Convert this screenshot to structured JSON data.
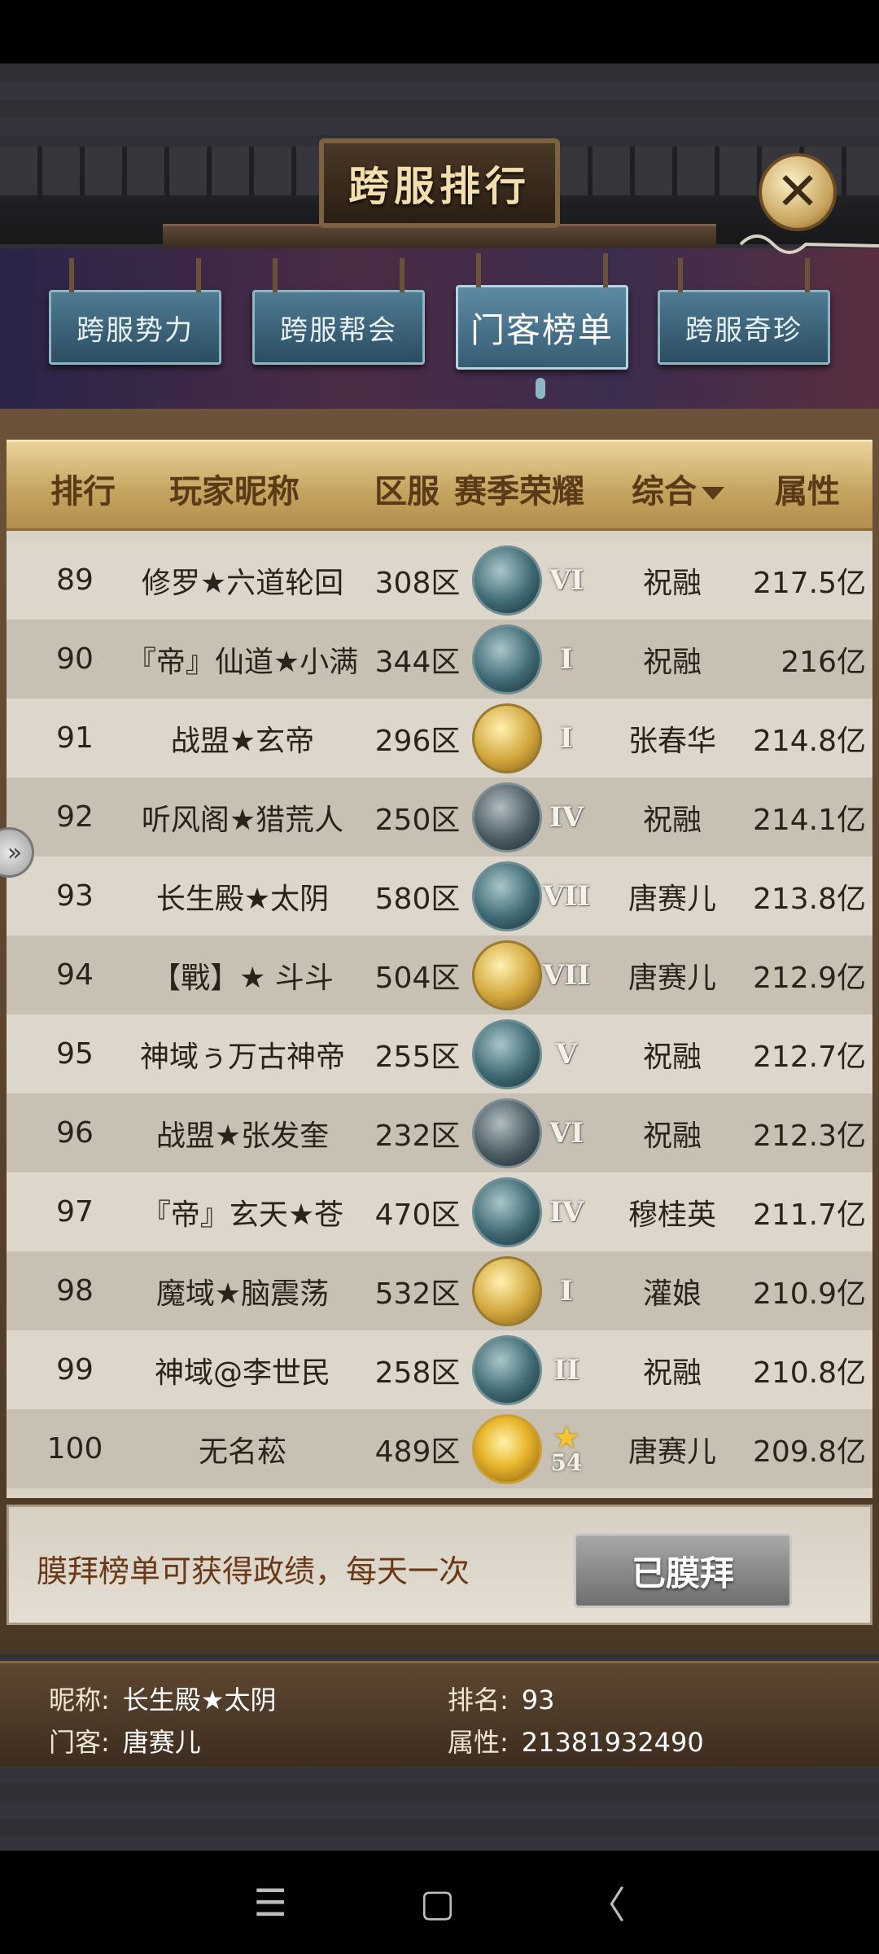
{
  "window": {
    "title": "跨服排行",
    "close_icon": "close-icon"
  },
  "tabs": [
    {
      "label": "跨服势力",
      "active": false
    },
    {
      "label": "跨服帮会",
      "active": false
    },
    {
      "label": "门客榜单",
      "active": true
    },
    {
      "label": "跨服奇珍",
      "active": false
    }
  ],
  "table": {
    "headers": {
      "rank": "排行",
      "name": "玩家昵称",
      "server": "区服",
      "honor": "赛季荣耀",
      "overall": "综合",
      "attr": "属性"
    },
    "rows": [
      {
        "rank": "89",
        "name": "修罗★六道轮回",
        "server": "308区",
        "badge": "dragon-badge-icon",
        "tier": "VI",
        "hero": "祝融",
        "attr": "217.5亿"
      },
      {
        "rank": "90",
        "name": "『帝』仙道★小满",
        "server": "344区",
        "badge": "dragon-badge-icon",
        "tier": "I",
        "hero": "祝融",
        "attr": "216亿"
      },
      {
        "rank": "91",
        "name": "战盟★玄帝",
        "server": "296区",
        "badge": "elephant-badge-icon",
        "tier": "I",
        "hero": "张春华",
        "attr": "214.8亿"
      },
      {
        "rank": "92",
        "name": "听风阁★猎荒人",
        "server": "250区",
        "badge": "serpent-badge-icon",
        "tier": "IV",
        "hero": "祝融",
        "attr": "214.1亿"
      },
      {
        "rank": "93",
        "name": "长生殿★太阴",
        "server": "580区",
        "badge": "dragon-badge-icon",
        "tier": "VII",
        "hero": "唐赛儿",
        "attr": "213.8亿"
      },
      {
        "rank": "94",
        "name": "【戰】★ 斗斗",
        "server": "504区",
        "badge": "elephant-badge-icon",
        "tier": "VII",
        "hero": "唐赛儿",
        "attr": "212.9亿"
      },
      {
        "rank": "95",
        "name": "神域ぅ万古神帝",
        "server": "255区",
        "badge": "dragon-badge-icon",
        "tier": "V",
        "hero": "祝融",
        "attr": "212.7亿"
      },
      {
        "rank": "96",
        "name": "战盟★张发奎",
        "server": "232区",
        "badge": "serpent-badge-icon",
        "tier": "VI",
        "hero": "祝融",
        "attr": "212.3亿"
      },
      {
        "rank": "97",
        "name": "『帝』玄天★苍",
        "server": "470区",
        "badge": "dragon-badge-icon",
        "tier": "IV",
        "hero": "穆桂英",
        "attr": "211.7亿"
      },
      {
        "rank": "98",
        "name": "魔域★脑震荡",
        "server": "532区",
        "badge": "elephant-badge-icon",
        "tier": "I",
        "hero": "灌娘",
        "attr": "210.9亿"
      },
      {
        "rank": "99",
        "name": "神域@李世民",
        "server": "258区",
        "badge": "dragon-badge-icon",
        "tier": "II",
        "hero": "祝融",
        "attr": "210.8亿"
      },
      {
        "rank": "100",
        "name": "无名菘",
        "server": "489区",
        "badge": "golden-dragon-badge-icon",
        "tier": "★",
        "level": "54",
        "hero": "唐赛儿",
        "attr": "209.8亿"
      }
    ]
  },
  "worship": {
    "text": "膜拜榜单可获得政绩，每天一次",
    "button": "已膜拜"
  },
  "my_info": {
    "nickname_label": "昵称:",
    "nickname": "长生殿★太阴",
    "hero_label": "门客:",
    "hero": "唐赛儿",
    "rank_label": "排名:",
    "rank": "93",
    "attr_label": "属性:",
    "attr": "21381932490"
  },
  "nav": {
    "menu": "☰",
    "home": "▢",
    "back": "〈"
  }
}
